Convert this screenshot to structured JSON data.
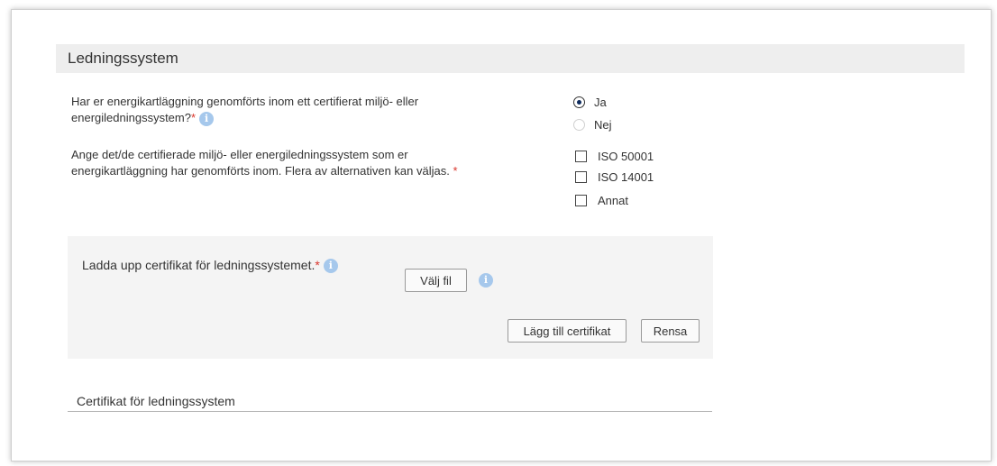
{
  "section": {
    "title": "Ledningssystem"
  },
  "question1": {
    "line1": "Har er energikartläggning genomförts inom ett certifierat miljö- eller",
    "line2": "energiledningssystem?",
    "required": "*",
    "options": [
      "Ja",
      "Nej"
    ],
    "selected": "Ja"
  },
  "question2": {
    "line1": "Ange det/de certifierade miljö- eller energiledningssystem som er",
    "line2": "energikartläggning har genomförts inom. Flera av alternativen kan väljas.",
    "required": "*",
    "options": [
      "ISO 50001",
      "ISO 14001",
      "Annat"
    ]
  },
  "upload": {
    "label": "Ladda upp certifikat för ledningssystemet.",
    "required": "*",
    "choose_file": "Välj fil",
    "add_button": "Lägg till certifikat",
    "clear_button": "Rensa"
  },
  "certificate_list": {
    "title": "Certifikat för ledningssystem"
  },
  "icons": {
    "info": "info-icon"
  },
  "colors": {
    "required": "#d9352b",
    "info": "#a6c8ec",
    "header_bg": "#eeeeee",
    "upload_bg": "#f4f4f4"
  }
}
